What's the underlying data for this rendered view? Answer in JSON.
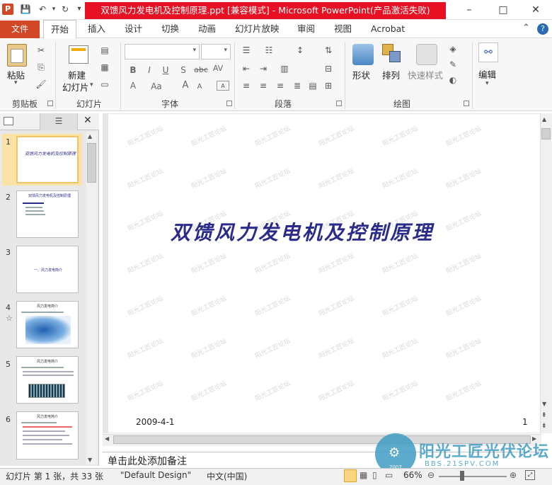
{
  "window": {
    "title": "双馈风力发电机及控制原理.ppt [兼容模式] - Microsoft PowerPoint(产品激活失败)",
    "minimize": "–",
    "maximize": "□",
    "close": "✕"
  },
  "quick_access": {
    "save": "💾",
    "undo": "↶",
    "redo": "↻",
    "more": "▾"
  },
  "tabs": {
    "file": "文件",
    "items": [
      "开始",
      "插入",
      "设计",
      "切换",
      "动画",
      "幻灯片放映",
      "审阅",
      "视图",
      "Acrobat"
    ],
    "active": "开始",
    "collapse": "⌃",
    "help": "?"
  },
  "ribbon": {
    "clipboard": {
      "paste": "粘贴",
      "group": "剪贴板"
    },
    "slides": {
      "new_slide_1": "新建",
      "new_slide_2": "幻灯片",
      "group": "幻灯片"
    },
    "font": {
      "group": "字体",
      "bold": "B",
      "italic": "I",
      "underline": "U",
      "shadow": "S",
      "strike": "abc",
      "spacing": "AV",
      "font_color": "A",
      "change_case": "Aa",
      "grow": "A",
      "shrink": "A"
    },
    "paragraph": {
      "group": "段落"
    },
    "drawing": {
      "shapes": "形状",
      "arrange": "排列",
      "quick_styles": "快速样式",
      "group": "绘图"
    },
    "editing": {
      "edit": "编辑"
    }
  },
  "left_panel": {
    "slides": [
      {
        "num": "1",
        "title": "双馈风力发电机及控制原理",
        "star": ""
      },
      {
        "num": "2",
        "title": "双馈风力发电机及控制原理",
        "star": ""
      },
      {
        "num": "3",
        "title": "一、风力发电简介",
        "star": ""
      },
      {
        "num": "4",
        "title": "风力发电简介",
        "star": "☆"
      },
      {
        "num": "5",
        "title": "风力发电简介",
        "star": ""
      },
      {
        "num": "6",
        "title": "风力发电简介",
        "star": ""
      }
    ]
  },
  "slide": {
    "title": "双馈风力发电机及控制原理",
    "date": "2009-4-1",
    "page": "1",
    "watermark": "阳光工匠论坛"
  },
  "notes": {
    "placeholder": "单击此处添加备注"
  },
  "status": {
    "slide_info": "幻灯片 第 1 张，共 33 张",
    "theme": "\"Default Design\"",
    "language": "中文(中国)",
    "zoom": "66%"
  },
  "brand": {
    "name": "阳光工匠光伏论坛",
    "url": "BBS.21SPV.COM",
    "year": "2007"
  },
  "colors": {
    "file_tab": "#d24726",
    "title_banner": "#e81123",
    "slide_title": "#2b2b8a"
  }
}
